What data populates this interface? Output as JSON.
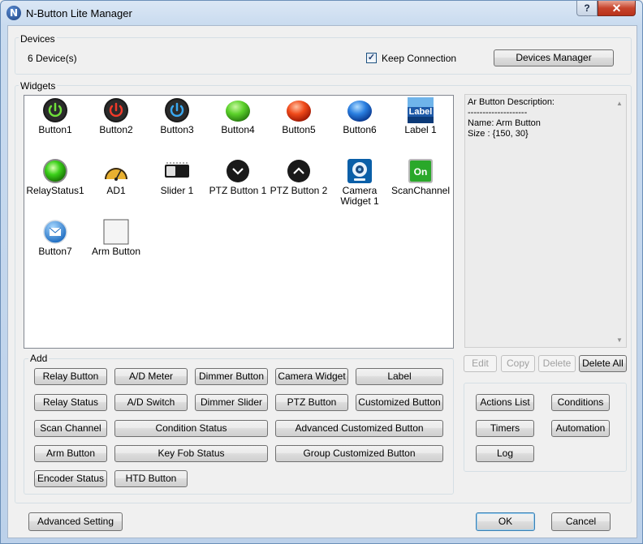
{
  "window": {
    "title": "N-Button Lite Manager",
    "help_label": "?",
    "close_label": "✕"
  },
  "devices": {
    "group_label": "Devices",
    "count_text": "6 Device(s)",
    "keep_connection_label": "Keep Connection",
    "keep_connection_checked": true,
    "check_mark": "✓",
    "manager_button": "Devices Manager"
  },
  "widgets": {
    "group_label": "Widgets",
    "items": [
      {
        "label": "Button1",
        "icon": "power-green-icon"
      },
      {
        "label": "Button2",
        "icon": "power-red-icon"
      },
      {
        "label": "Button3",
        "icon": "power-blue-icon"
      },
      {
        "label": "Button4",
        "icon": "green-orb-icon"
      },
      {
        "label": "Button5",
        "icon": "red-orb-icon"
      },
      {
        "label": "Button6",
        "icon": "blue-orb-icon"
      },
      {
        "label": "Label 1",
        "icon": "label-icon",
        "icon_text": "Label"
      },
      {
        "label": "RelayStatus1",
        "icon": "green-light-icon"
      },
      {
        "label": "AD1",
        "icon": "gauge-icon"
      },
      {
        "label": "Slider 1",
        "icon": "slider-icon"
      },
      {
        "label": "PTZ Button 1",
        "icon": "chevron-down-icon"
      },
      {
        "label": "PTZ Button 2",
        "icon": "chevron-up-icon"
      },
      {
        "label": "Camera Widget 1",
        "icon": "webcam-icon"
      },
      {
        "label": "ScanChannel",
        "icon": "on-switch-icon",
        "icon_text": "On"
      },
      {
        "label": "Button7",
        "icon": "mail-icon"
      },
      {
        "label": "Arm Button",
        "icon": "blank-button-icon"
      }
    ]
  },
  "description": {
    "lines": [
      "Ar Button Description:",
      "--------------------",
      "Name: Arm Button",
      "Size : {150, 30}"
    ],
    "scroll_up": "▲",
    "scroll_down": "▼"
  },
  "description_actions": {
    "edit": "Edit",
    "copy": "Copy",
    "delete": "Delete",
    "delete_all": "Delete All"
  },
  "add": {
    "group_label": "Add",
    "buttons": {
      "relay_button": "Relay Button",
      "ad_meter": "A/D Meter",
      "dimmer_button": "Dimmer Button",
      "camera_widget": "Camera Widget",
      "label": "Label",
      "relay_status": "Relay Status",
      "ad_switch": "A/D Switch",
      "dimmer_slider": "Dimmer Slider",
      "ptz_button": "PTZ Button",
      "customized_button": "Customized Button",
      "scan_channel": "Scan Channel",
      "condition_status": "Condition Status",
      "advanced_customized_button": "Advanced Customized Button",
      "arm_button": "Arm Button",
      "key_fob_status": "Key Fob Status",
      "group_customized_button": "Group Customized Button",
      "encoder_status": "Encoder Status",
      "htd_button": "HTD Button"
    }
  },
  "side_actions": {
    "actions_list": "Actions List",
    "conditions": "Conditions",
    "timers": "Timers",
    "automation": "Automation",
    "log": "Log"
  },
  "footer": {
    "advanced_setting": "Advanced Setting",
    "ok": "OK",
    "cancel": "Cancel"
  }
}
